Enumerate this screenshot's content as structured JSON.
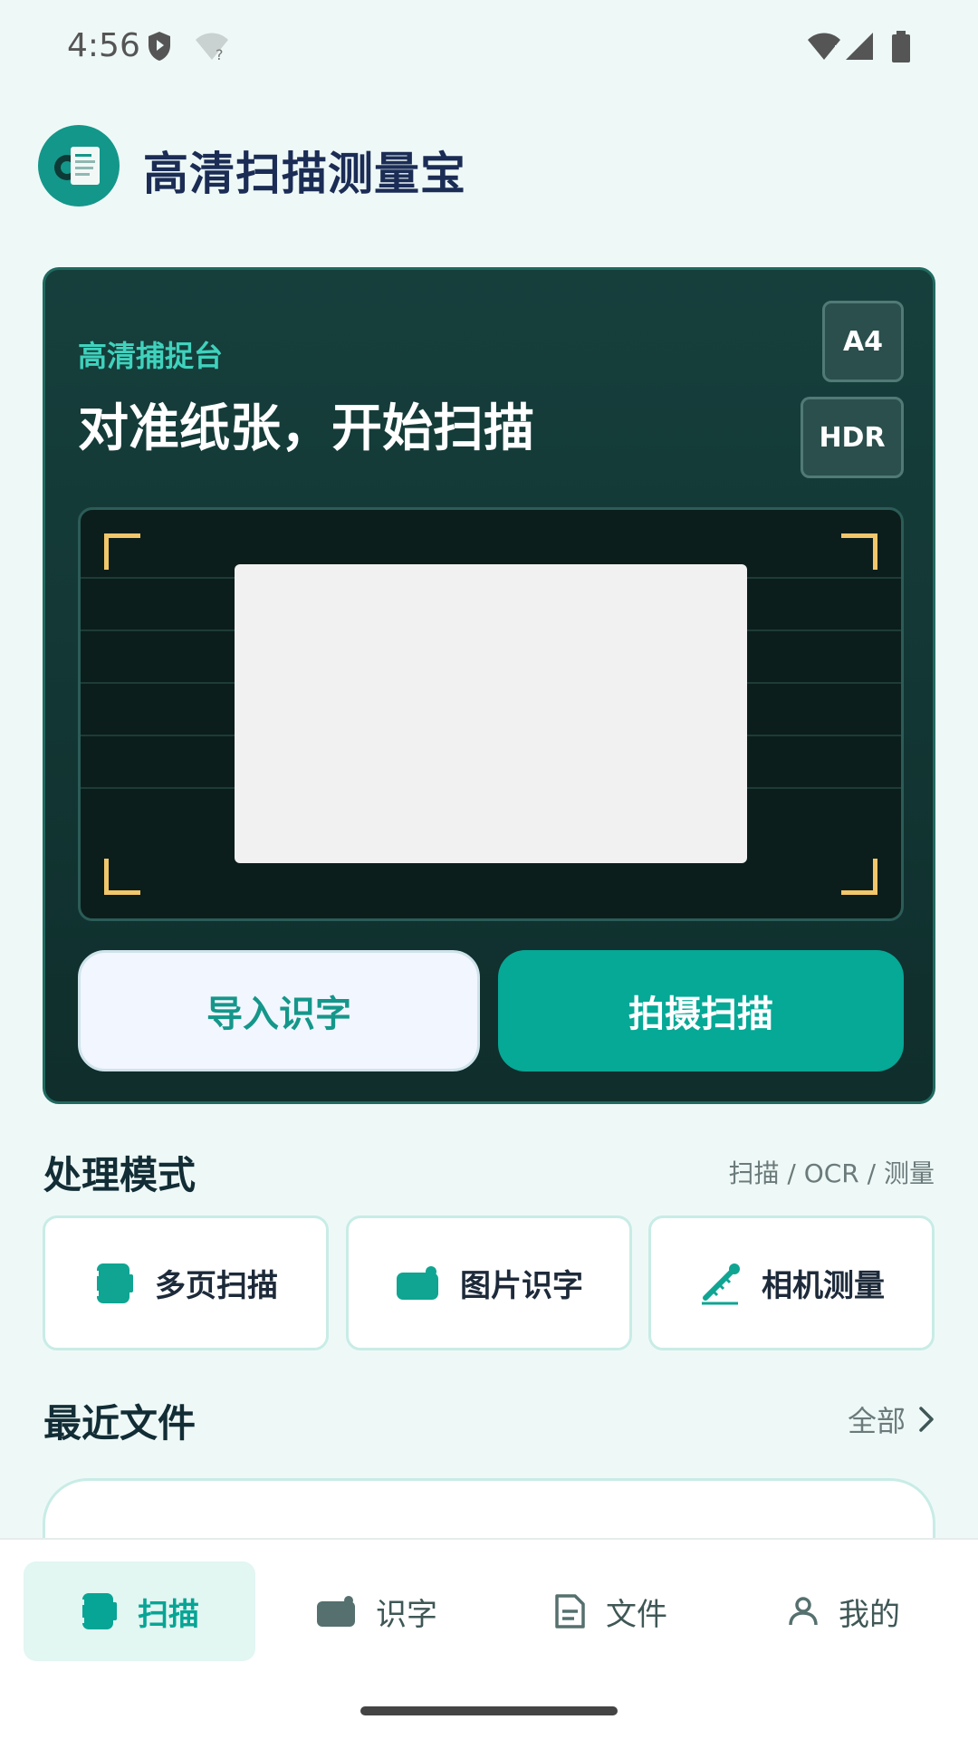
{
  "status_bar": {
    "time": "4:56",
    "icons": [
      "shield-icon",
      "wifi-question-icon",
      "wifi-alert-icon",
      "cell-signal-icon",
      "battery-icon"
    ]
  },
  "app": {
    "title": "高清扫描测量宝",
    "logo_icon": "scanner-logo-icon"
  },
  "capture_card": {
    "kicker": "高清捕捉台",
    "title": "对准纸张，开始扫描",
    "chips": [
      "A4",
      "HDR"
    ],
    "import_button": "导入识字",
    "shoot_button": "拍摄扫描"
  },
  "modes": {
    "title": "处理模式",
    "hint": "扫描 / OCR / 测量",
    "items": [
      {
        "label": "多页扫描",
        "icon": "multi-page-scan-icon"
      },
      {
        "label": "图片识字",
        "icon": "image-ocr-icon"
      },
      {
        "label": "相机测量",
        "icon": "ruler-measure-icon"
      }
    ]
  },
  "recent": {
    "title": "最近文件",
    "link": "全部"
  },
  "bottom_nav": {
    "active": "扫描",
    "items": [
      {
        "label": "扫描",
        "icon": "scan-icon"
      },
      {
        "label": "识字",
        "icon": "ocr-icon"
      },
      {
        "label": "文件",
        "icon": "file-icon"
      },
      {
        "label": "我的",
        "icon": "person-icon"
      }
    ]
  },
  "colors": {
    "accent": "#06a896",
    "card_bg": "#163f3c",
    "background": "#eef9f7",
    "corner_marker": "#f2c66a",
    "title_text": "#1b2c55"
  }
}
